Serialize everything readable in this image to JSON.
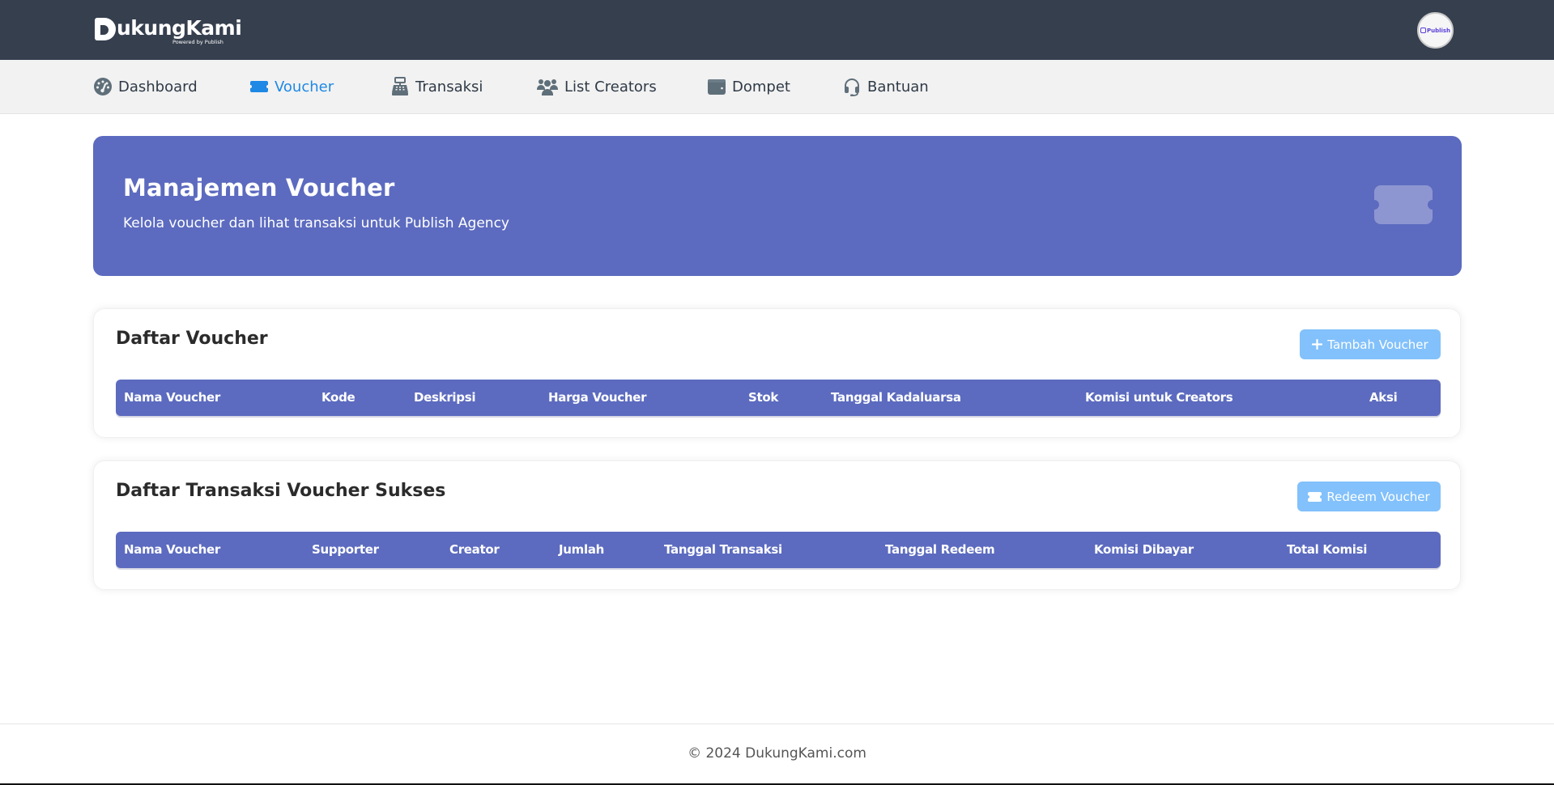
{
  "brand": {
    "name": "DukungKami",
    "name_rest": "ukungKami",
    "tagline": "Powered by Publish",
    "avatar_label": "Publish"
  },
  "nav": {
    "items": [
      {
        "label": "Dashboard",
        "icon": "gauge-icon",
        "active": false
      },
      {
        "label": "Voucher",
        "icon": "ticket-icon",
        "active": true
      },
      {
        "label": "Transaksi",
        "icon": "cash-register-icon",
        "active": false
      },
      {
        "label": "List Creators",
        "icon": "users-icon",
        "active": false
      },
      {
        "label": "Dompet",
        "icon": "wallet-icon",
        "active": false
      },
      {
        "label": "Bantuan",
        "icon": "headset-icon",
        "active": false
      }
    ]
  },
  "banner": {
    "title": "Manajemen Voucher",
    "subtitle": "Kelola voucher dan lihat transaksi untuk Publish Agency",
    "icon": "ticket-icon"
  },
  "voucher_list": {
    "title": "Daftar Voucher",
    "add_button": "Tambah Voucher",
    "columns": [
      "Nama Voucher",
      "Kode",
      "Deskripsi",
      "Harga Voucher",
      "Stok",
      "Tanggal Kadaluarsa",
      "Komisi untuk Creators",
      "Aksi"
    ],
    "rows": []
  },
  "transaction_list": {
    "title": "Daftar Transaksi Voucher Sukses",
    "redeem_button": "Redeem Voucher",
    "columns": [
      "Nama Voucher",
      "Supporter",
      "Creator",
      "Jumlah",
      "Tanggal Transaksi",
      "Tanggal Redeem",
      "Komisi Dibayar",
      "Total Komisi"
    ],
    "rows": []
  },
  "footer": {
    "text": "© 2024 DukungKami.com"
  },
  "colors": {
    "header_bg": "#363f4e",
    "nav_bg": "#f2f2f2",
    "accent": "#5c6bbf",
    "active_nav": "#1e88e5",
    "button": "#82c1fb"
  }
}
